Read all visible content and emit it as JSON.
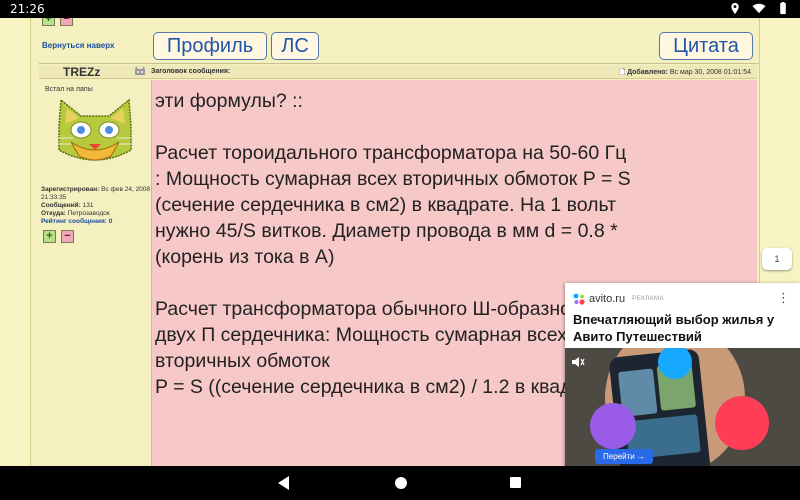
{
  "status_bar": {
    "time": "21:26"
  },
  "nav": {
    "back_to_top": "Вернуться наверх"
  },
  "buttons": {
    "plus": "+",
    "minus": "−",
    "profile": "Профиль",
    "pm": "ЛС",
    "quote": "Цитата"
  },
  "post": {
    "author": "TREZz",
    "subject_label": "Заголовок сообщения:",
    "added_label": "Добавлено:",
    "added_date": "Вс мар 30, 2008 01:01:54",
    "rank": "Встал на лапы",
    "registered_label": "Зарегистрирован:",
    "registered_value": "Вс фев 24, 2008 21:33:35",
    "messages_label": "Сообщений:",
    "messages_value": "131",
    "from_label": "Откуда:",
    "from_value": "Петрозаводок",
    "rating_label": "Рейтинг сообщения:",
    "rating_value": "0",
    "text": "эти формулы? ::\n\nРасчет тороидального трансформатора на 50-60 Гц : Мощность сумарная всех вторичных обмоток P = S (сечение сердечника в см2) в квадрате. На 1 вольт нужно 45/S витков. Диаметр провода в мм d = 0.8 * (корень из тока в А)\n\nРасчет трансформатора обычного Ш-образного или двух П сердечника: Мощность сумарная всех вторичных обмоток\nP = S ((сечение сердечника в см2) / 1.2 в квадрате"
  },
  "page_counter": "1",
  "ad": {
    "domain": "avito.ru",
    "label": "РЕКЛАМА",
    "title": "Впечатляющий выбор жилья у Авито Путешествий",
    "cta": "Перейти →"
  },
  "colors": {
    "page_bg": "#f4f0c0",
    "post_bg": "#f7c8c8",
    "link": "#1a4fa0"
  }
}
